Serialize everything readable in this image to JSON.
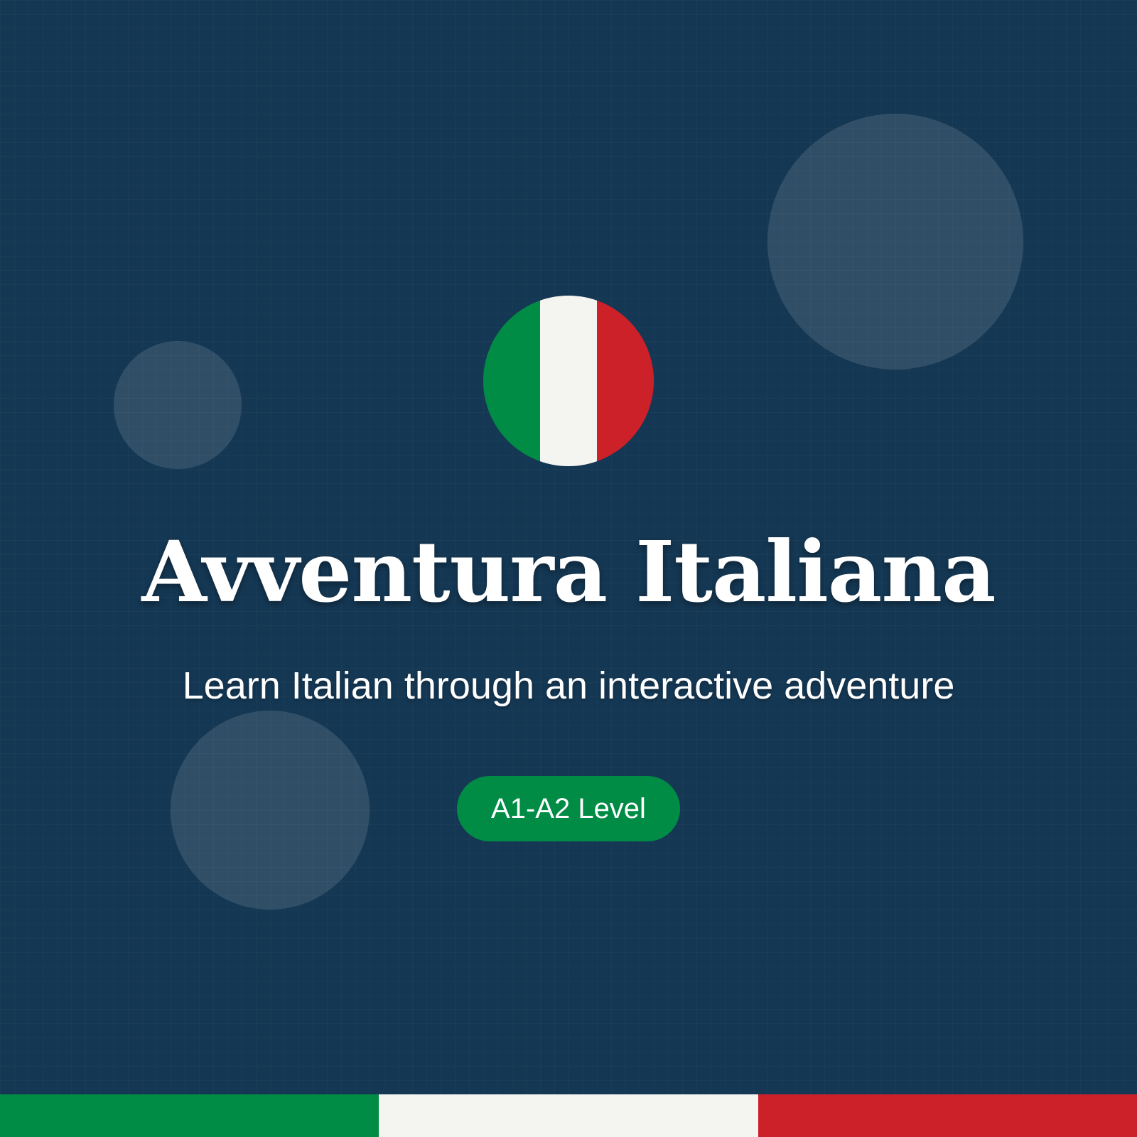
{
  "title": "Avventura Italiana",
  "subtitle": "Learn Italian through an interactive adventure",
  "level_badge": "A1-A2 Level",
  "colors": {
    "background": "#143753",
    "flag_green": "#008c45",
    "flag_white": "#f4f5f0",
    "flag_red": "#cd212a",
    "text": "#ffffff"
  },
  "icons": {
    "emblem": "italian-flag-icon"
  }
}
